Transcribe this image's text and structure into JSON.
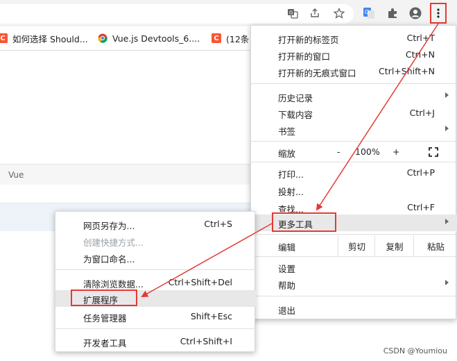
{
  "bookmarks": [
    {
      "label": "如何选择 Should...",
      "favicon": "C"
    },
    {
      "label": "Vue.js Devtools_6....",
      "favicon": "chrome-icon"
    },
    {
      "label": "(12条",
      "favicon": "C"
    }
  ],
  "page": {
    "tab_label": "Vue"
  },
  "menu": {
    "new_tab": {
      "label": "打开新的标签页",
      "shortcut": "Ctrl+T"
    },
    "new_window": {
      "label": "打开新的窗口",
      "shortcut": "Ctrl+N"
    },
    "new_incognito": {
      "label": "打开新的无痕式窗口",
      "shortcut": "Ctrl+Shift+N"
    },
    "history": {
      "label": "历史记录"
    },
    "downloads": {
      "label": "下载内容",
      "shortcut": "Ctrl+J"
    },
    "bookmarks": {
      "label": "书签"
    },
    "zoom": {
      "label": "缩放",
      "minus": "-",
      "value": "100%",
      "plus": "+"
    },
    "print": {
      "label": "打印...",
      "shortcut": "Ctrl+P"
    },
    "cast": {
      "label": "投射..."
    },
    "find": {
      "label": "查找...",
      "shortcut": "Ctrl+F"
    },
    "more_tools": {
      "label": "更多工具"
    },
    "edit": {
      "label": "编辑",
      "cut": "剪切",
      "copy": "复制",
      "paste": "粘贴"
    },
    "settings": {
      "label": "设置"
    },
    "help": {
      "label": "帮助"
    },
    "exit": {
      "label": "退出"
    }
  },
  "submenu": {
    "save_page": {
      "label": "网页另存为...",
      "shortcut": "Ctrl+S"
    },
    "create_shortcut": {
      "label": "创建快捷方式..."
    },
    "name_window": {
      "label": "为窗口命名..."
    },
    "clear_data": {
      "label": "清除浏览数据...",
      "shortcut": "Ctrl+Shift+Del"
    },
    "extensions": {
      "label": "扩展程序"
    },
    "task_manager": {
      "label": "任务管理器",
      "shortcut": "Shift+Esc"
    },
    "dev_tools": {
      "label": "开发者工具",
      "shortcut": "Ctrl+Shift+I"
    }
  },
  "watermark": "CSDN @Youmiou",
  "colors": {
    "annotation_red": "#e53935",
    "highlight": "#e8e8e8"
  }
}
